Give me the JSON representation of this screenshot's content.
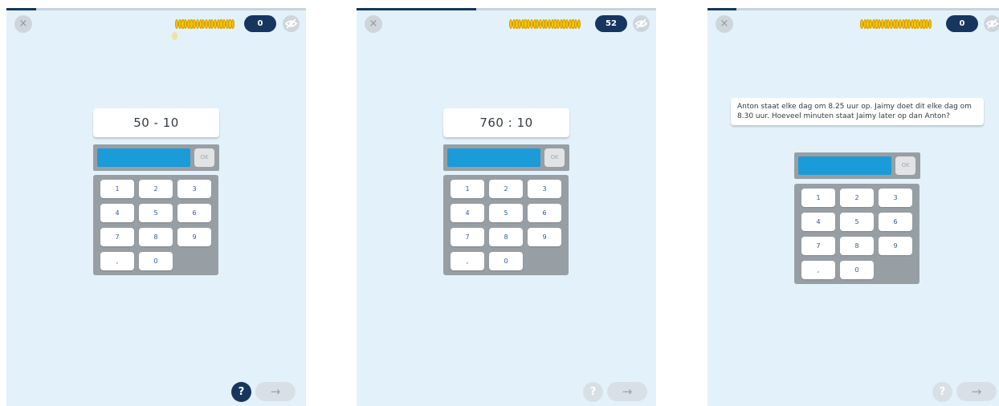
{
  "colors": {
    "navy": "#16365f",
    "panel_bg": "#e3f1fa",
    "input_blue": "#1b9bd8",
    "keypad_gray": "#989fa4",
    "coin": "#f2c500",
    "key_text": "#2c5aa0"
  },
  "icons": {
    "close": "×",
    "arrow": "→",
    "eye_off": "eye-off-icon",
    "coin": "coin-icon"
  },
  "panels": [
    {
      "progress": 0.1,
      "score": "0",
      "question": "50 - 10",
      "ok_label": "OK",
      "help_label": "?",
      "keys": [
        "1",
        "2",
        "3",
        "4",
        "5",
        "6",
        "7",
        "8",
        "9",
        ",",
        "0"
      ]
    },
    {
      "progress": 0.4,
      "score": "52",
      "question": "760 : 10",
      "ok_label": "OK",
      "help_label": "?",
      "keys": [
        "1",
        "2",
        "3",
        "4",
        "5",
        "6",
        "7",
        "8",
        "9",
        ",",
        "0"
      ]
    },
    {
      "progress": 0.1,
      "score": "0",
      "question": "Anton staat elke dag om 8.25 uur op. Jaimy doet dit elke dag om 8.30 uur. Hoeveel minuten staat Jaimy later op dan Anton?",
      "ok_label": "OK",
      "help_label": "?",
      "keys": [
        "1",
        "2",
        "3",
        "4",
        "5",
        "6",
        "7",
        "8",
        "9",
        ",",
        "0"
      ]
    }
  ]
}
